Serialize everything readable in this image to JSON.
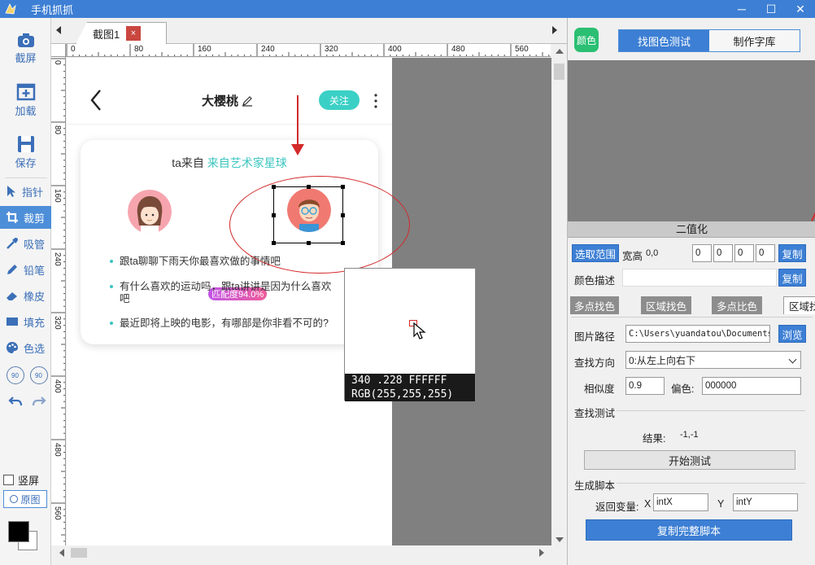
{
  "window": {
    "title": "手机抓抓",
    "minimize": "─",
    "maximize": "☐",
    "close": "✕"
  },
  "toolbar": {
    "screenshot": "截屏",
    "load": "加载",
    "save": "保存",
    "pointer": "指针",
    "crop": "裁剪",
    "pick": "吸管",
    "pencil": "铅笔",
    "eraser": "橡皮",
    "fill": "填充",
    "color_pick": "色选",
    "rotate_left": "90",
    "rotate_right": "90",
    "portrait": "竖屏",
    "original": "原图",
    "fg_color": "#000000",
    "bg_color": "#ffffff"
  },
  "canvas": {
    "tab_label": "截图1",
    "tab_close": "×",
    "ruler_top": [
      "0",
      "80",
      "160",
      "240",
      "320",
      "400",
      "480",
      "560"
    ],
    "ruler_left": [
      "0",
      "80",
      "160",
      "240",
      "320",
      "400",
      "480",
      "560"
    ]
  },
  "phone": {
    "nickname": "大樱桃",
    "follow": "关注",
    "card_title_prefix": "ta来自",
    "card_title_highlight": "来自艺术家星球",
    "match": "匹配度94.0%",
    "questions": [
      "跟ta聊聊下雨天你最喜欢做的事情吧",
      "有什么喜欢的运动吗，跟ta讲讲是因为什么喜欢",
      "吧",
      "最近即将上映的电影，有哪部是你非看不可的?"
    ],
    "accent_color": "#3bc5c0"
  },
  "magnifier": {
    "line1": "340 .228  FFFFFF",
    "line2": "RGB(255,255,255)"
  },
  "right_panel": {
    "color_badge": "颜色",
    "tab_find": "找图色测试",
    "tab_font": "制作字库",
    "binarize": "二值化",
    "select_range": "选取范围",
    "wh_label": "宽高",
    "wh_value": "0,0",
    "range_vals": [
      "0",
      "0",
      "0",
      "0"
    ],
    "copy": "复制",
    "color_desc": "颜色描述",
    "subtabs": [
      "多点找色",
      "区域找色",
      "多点比色",
      "区域找"
    ],
    "image_path_label": "图片路径",
    "image_path": "C:\\Users\\yuandatou\\Documents\\",
    "browse": "浏览",
    "direction_label": "查找方向",
    "direction_value": "0:从左上向右下",
    "similarity_label": "相似度",
    "similarity_value": "0.9",
    "offset_label": "偏色:",
    "offset_value": "000000",
    "find_test": "查找测试",
    "result_label": "结果:",
    "result_value": "-1,-1",
    "start_test": "开始测试",
    "gen_script": "生成脚本",
    "return_var": "返回变量:",
    "x_label": "X",
    "x_value": "intX",
    "y_label": "Y",
    "y_value": "intY",
    "copy_script": "复制完整脚本"
  }
}
